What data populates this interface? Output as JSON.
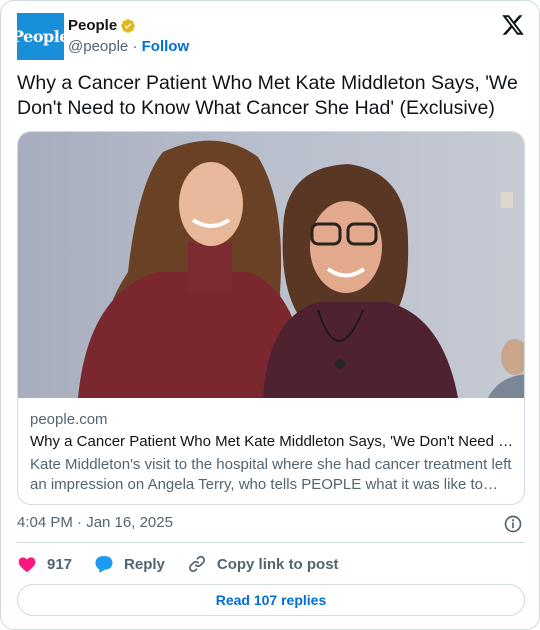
{
  "account": {
    "avatar_text": "People",
    "name": "People",
    "handle": "@people",
    "separator": "·",
    "follow_label": "Follow",
    "verified_color": "#e2b719"
  },
  "tweet": {
    "text": "Why a Cancer Patient Who Met Kate Middleton Says, 'We Don't Need to Know What Cancer She Had' (Exclusive)",
    "timestamp": "4:04 PM · Jan 16, 2025"
  },
  "link_card": {
    "domain": "people.com",
    "title": "Why a Cancer Patient Who Met Kate Middleton Says, 'We Don't Need to Know What Cancer She Had' (Exclusive)",
    "description": "Kate Middleton's visit to the hospital where she had cancer treatment left an impression on Angela Terry, who tells PEOPLE what it was like to meet the princess"
  },
  "actions": {
    "like_count": "917",
    "reply_label": "Reply",
    "copy_label": "Copy link to post"
  },
  "read_replies_label": "Read 107 replies",
  "icons": [
    "x-logo-icon",
    "verified-badge-icon",
    "info-icon",
    "heart-icon",
    "reply-bubble-icon",
    "link-icon"
  ],
  "colors": {
    "link_blue": "#006fd6",
    "like_red": "#f91880",
    "reply_blue": "#1d9bf0",
    "muted_text": "#536471",
    "border": "#cfd9de"
  }
}
